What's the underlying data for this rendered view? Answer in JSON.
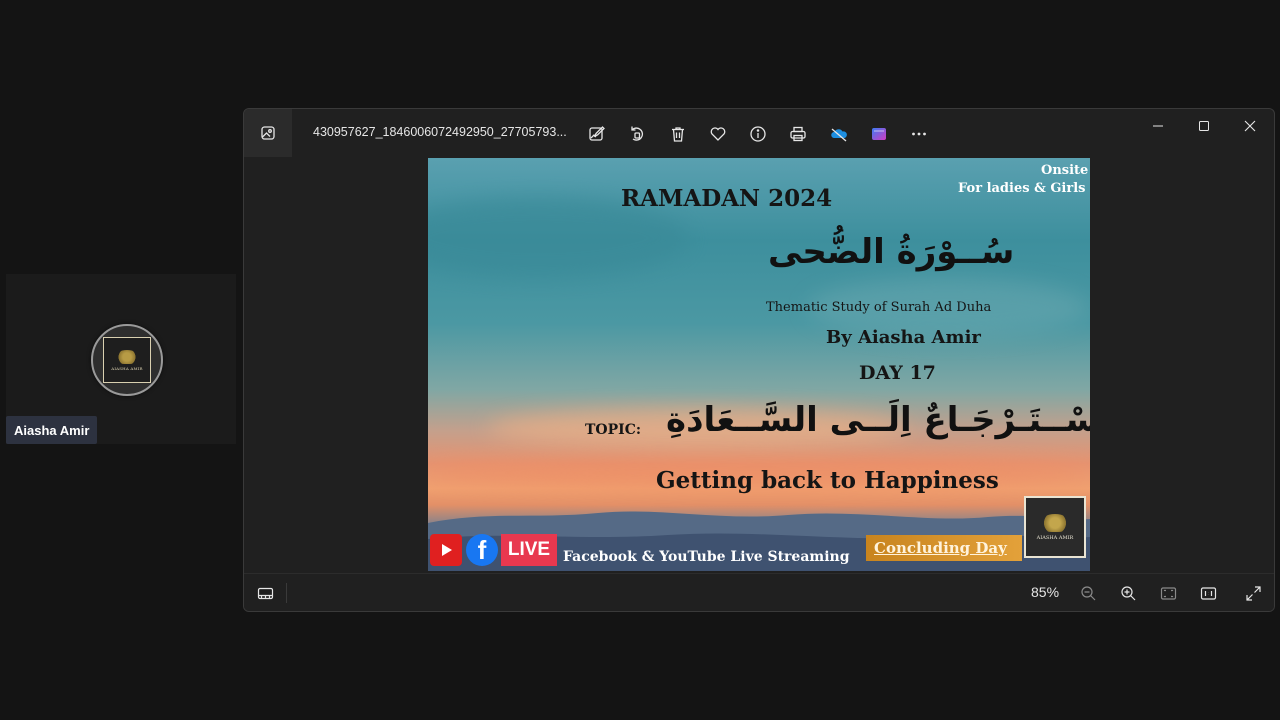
{
  "participant": {
    "name": "Aiasha Amir",
    "avatar_caption": "AIASHA AMIR"
  },
  "viewer": {
    "filename": "430957627_1846006072492950_27705793...",
    "toolbar": {
      "edit": "edit-image-icon",
      "rotate": "rotate-icon",
      "delete": "delete-icon",
      "favorite": "heart-icon",
      "info": "info-icon",
      "print": "print-icon",
      "onedrive": "onedrive-icon",
      "clipchamp": "clipchamp-icon",
      "more": "more-icon"
    },
    "zoom": "85%",
    "accent": "#0078d4"
  },
  "poster": {
    "onsite": "Onsite",
    "audience": "For ladies & Girls",
    "title": "RAMADAN 2024",
    "surah_arabic": "سُــوْرَةُ الضُّحى",
    "subtitle": "Thematic Study of Surah Ad Duha",
    "author": "By Aiasha Amir",
    "day": "DAY 17",
    "topic_label": "TOPIC:",
    "topic_arabic": "اِسْــتَـرْجَـاعٌ اِلَــى السَّــعَادَةِ",
    "topic_english": "Getting back to Happiness",
    "live_label": "LIVE",
    "streaming": "Facebook & YouTube Live Streaming",
    "concluding": "Concluding Day",
    "logo_caption": "AIASHA AMIR",
    "fb_glyph": "f"
  }
}
